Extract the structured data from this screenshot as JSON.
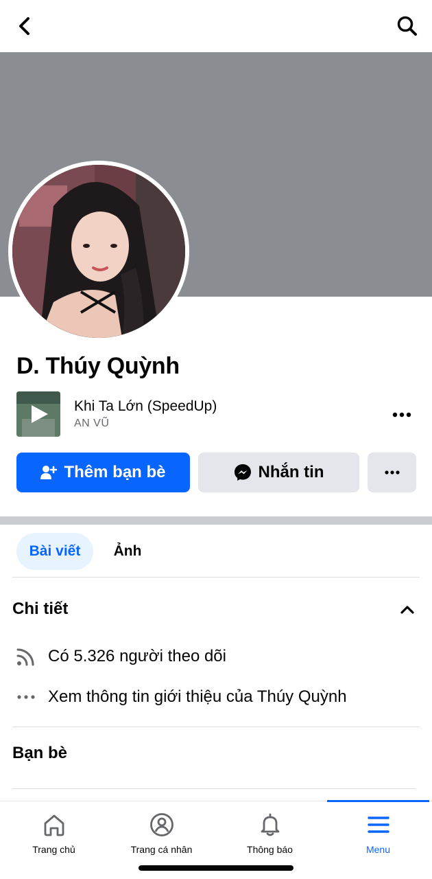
{
  "profile": {
    "name": "D. Thúy Quỳnh"
  },
  "music": {
    "title": "Khi Ta Lớn (SpeedUp)",
    "artist": "AN VŨ"
  },
  "actions": {
    "add_friend": "Thêm bạn bè",
    "message": "Nhắn tin"
  },
  "tabs": [
    {
      "label": "Bài viết",
      "active": true
    },
    {
      "label": "Ảnh",
      "active": false
    }
  ],
  "details": {
    "title": "Chi tiết",
    "followers": "Có 5.326 người theo dõi",
    "about": "Xem thông tin giới thiệu của Thúy Quỳnh"
  },
  "friends": {
    "title": "Bạn bè"
  },
  "nav": [
    {
      "label": "Trang chủ",
      "icon": "home-icon"
    },
    {
      "label": "Trang cá nhân",
      "icon": "profile-icon"
    },
    {
      "label": "Thông báo",
      "icon": "bell-icon"
    },
    {
      "label": "Menu",
      "icon": "menu-icon",
      "active": true
    }
  ],
  "colors": {
    "accent": "#0866ff",
    "cover": "#8a8d91",
    "button_gray": "#e4e6eb"
  }
}
